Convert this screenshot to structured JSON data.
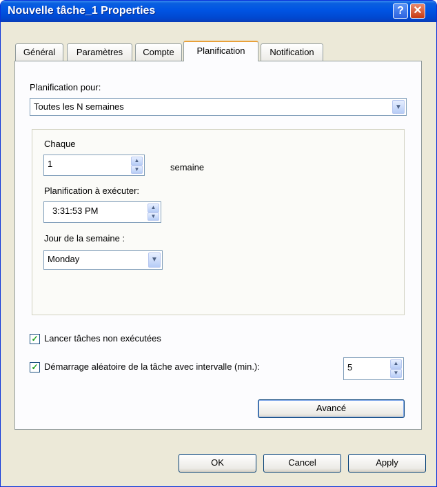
{
  "window": {
    "title": "Nouvelle tâche_1 Properties",
    "help_glyph": "?",
    "close_glyph": "✕"
  },
  "tabs": [
    {
      "label": "Général",
      "active": false
    },
    {
      "label": "Paramètres",
      "active": false
    },
    {
      "label": "Compte",
      "active": false
    },
    {
      "label": "Planification",
      "active": true
    },
    {
      "label": "Notification",
      "active": false
    }
  ],
  "schedule": {
    "for_label": "Planification pour:",
    "for_value": "Toutes les N semaines",
    "every_label": "Chaque",
    "every_value": "1",
    "every_unit": "semaine",
    "run_label": "Planification à exécuter:",
    "run_value": "3:31:53 PM",
    "weekday_label": "Jour de la semaine :",
    "weekday_value": "Monday"
  },
  "options": {
    "missed_label": "Lancer tâches non exécutées",
    "missed_checked": true,
    "random_label": "Démarrage aléatoire de la tâche avec intervalle (min.):",
    "random_checked": true,
    "random_value": "5"
  },
  "buttons": {
    "advanced": "Avancé",
    "ok": "OK",
    "cancel": "Cancel",
    "apply": "Apply"
  },
  "glyphs": {
    "dropdown": "▼",
    "up": "▲",
    "down": "▼",
    "check": "✓"
  }
}
